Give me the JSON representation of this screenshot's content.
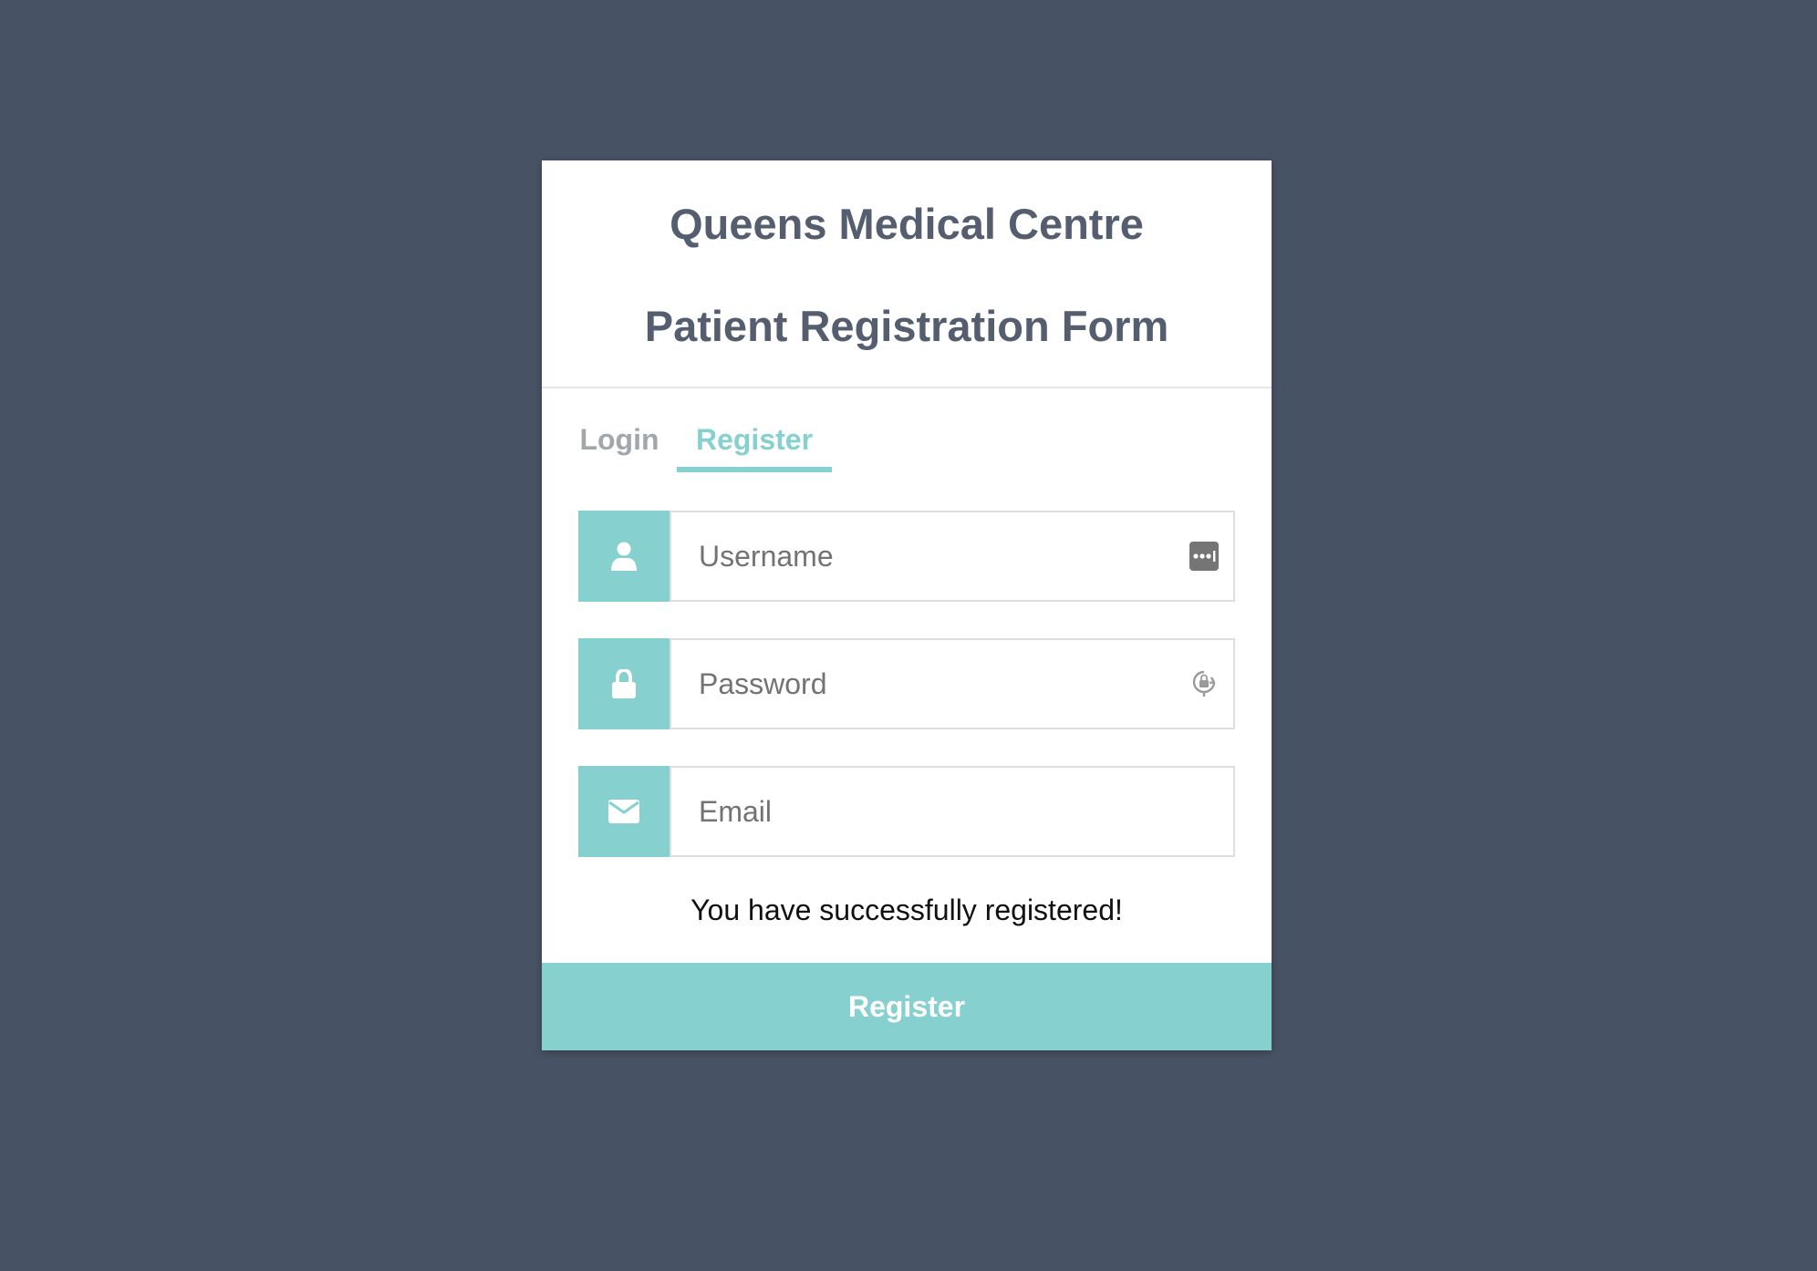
{
  "header": {
    "title_line1": "Queens Medical Centre",
    "title_line2": "Patient Registration Form"
  },
  "tabs": [
    {
      "label": "Login",
      "active": false
    },
    {
      "label": "Register",
      "active": true
    }
  ],
  "form": {
    "username": {
      "placeholder": "Username",
      "value": "",
      "icon": "user-icon",
      "helper_icon": "password-manager-icon"
    },
    "password": {
      "placeholder": "Password",
      "value": "",
      "icon": "lock-icon",
      "helper_icon": "password-key-icon"
    },
    "email": {
      "placeholder": "Email",
      "value": "",
      "icon": "envelope-icon"
    }
  },
  "message": "You have successfully registered!",
  "submit_label": "Register",
  "colors": {
    "background": "#475264",
    "accent": "#86d1cf",
    "title": "#545e6e",
    "inactive_tab": "#a2a7ae"
  }
}
